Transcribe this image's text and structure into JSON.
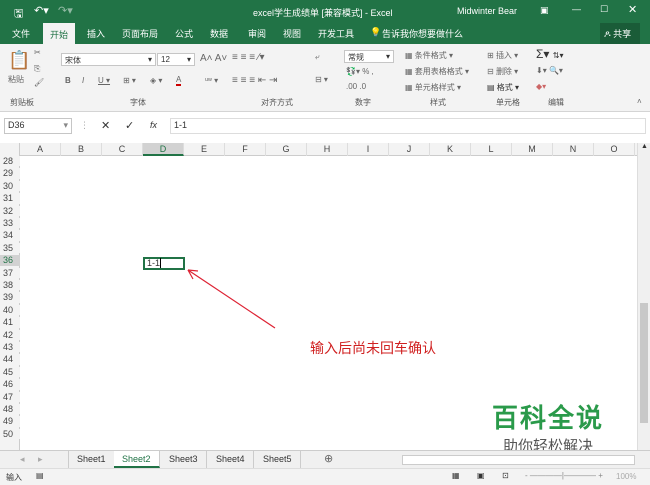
{
  "title": {
    "text": "excel学生成绩单  [兼容模式]  -  Excel",
    "user": "Midwinter Bear"
  },
  "tabs": [
    "文件",
    "开始",
    "插入",
    "页面布局",
    "公式",
    "数据",
    "审阅",
    "视图",
    "开发工具"
  ],
  "tell_me": "告诉我你想要做什么",
  "share": "共享",
  "ribbon": {
    "paste": "粘贴",
    "font_name": "宋体",
    "font_size": "12",
    "number_format": "常规",
    "cond_format": "条件格式",
    "table_format": "套用表格格式",
    "cell_style": "单元格样式",
    "insert": "插入",
    "delete": "删除",
    "format": "格式",
    "groups": [
      "剪贴板",
      "字体",
      "对齐方式",
      "数字",
      "样式",
      "单元格",
      "编辑"
    ]
  },
  "formula": {
    "name_box": "D36",
    "fx": "fx",
    "value": "1-1"
  },
  "columns": [
    "A",
    "B",
    "C",
    "D",
    "E",
    "F",
    "G",
    "H",
    "I",
    "J",
    "K",
    "L",
    "M",
    "N",
    "O"
  ],
  "rows": [
    "28",
    "29",
    "30",
    "31",
    "32",
    "33",
    "34",
    "35",
    "36",
    "37",
    "38",
    "39",
    "40",
    "41",
    "42",
    "43",
    "44",
    "45",
    "46",
    "47",
    "48",
    "49",
    "50"
  ],
  "cell": {
    "ref": "D36",
    "value": "1-1"
  },
  "annotation": "输入后尚未回车确认",
  "sheets": [
    "Sheet1",
    "Sheet2",
    "Sheet3",
    "Sheet4",
    "Sheet5"
  ],
  "active_sheet": "Sheet2",
  "status": {
    "mode": "输入",
    "zoom": "100%"
  },
  "watermark": {
    "title": "百科全说",
    "subtitle": "助你轻松解决"
  }
}
